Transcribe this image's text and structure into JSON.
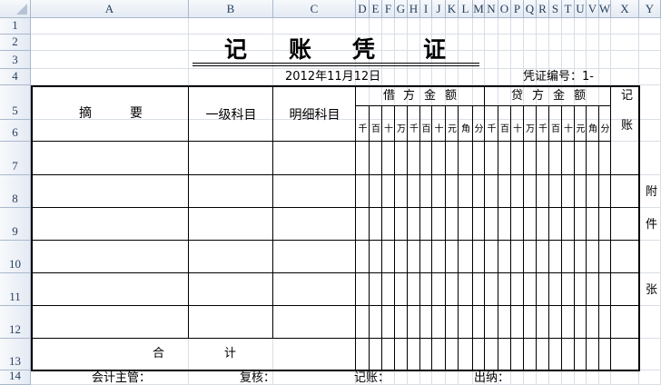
{
  "columns": [
    "A",
    "B",
    "C",
    "D",
    "E",
    "F",
    "G",
    "H",
    "I",
    "J",
    "K",
    "L",
    "M",
    "N",
    "O",
    "P",
    "Q",
    "R",
    "S",
    "T",
    "U",
    "V",
    "W",
    "X",
    "Y"
  ],
  "rows": [
    "1",
    "2",
    "3",
    "4",
    "5",
    "6",
    "7",
    "8",
    "9",
    "10",
    "11",
    "12",
    "13",
    "14"
  ],
  "voucher": {
    "title_chars": [
      "记",
      "账",
      "凭",
      "证"
    ],
    "date": "2012年11月12日",
    "number_label": "凭证编号：1-",
    "summary_chars": [
      "摘",
      "要"
    ],
    "level1_subject": "一级科目",
    "detail_subject": "明细科目",
    "debit_chars": [
      "借",
      "方",
      "金",
      "额"
    ],
    "credit_chars": [
      "贷",
      "方",
      "金",
      "额"
    ],
    "posted_chars": [
      "记",
      "账"
    ],
    "digit_units": [
      "千",
      "百",
      "十",
      "万",
      "千",
      "百",
      "十",
      "元",
      "角",
      "分"
    ],
    "attachment_chars": [
      "附",
      "件",
      "张"
    ],
    "total_chars": [
      "合",
      "计"
    ],
    "signatures": [
      "会计主管：",
      "复核：",
      "记账：",
      "出纳："
    ]
  }
}
